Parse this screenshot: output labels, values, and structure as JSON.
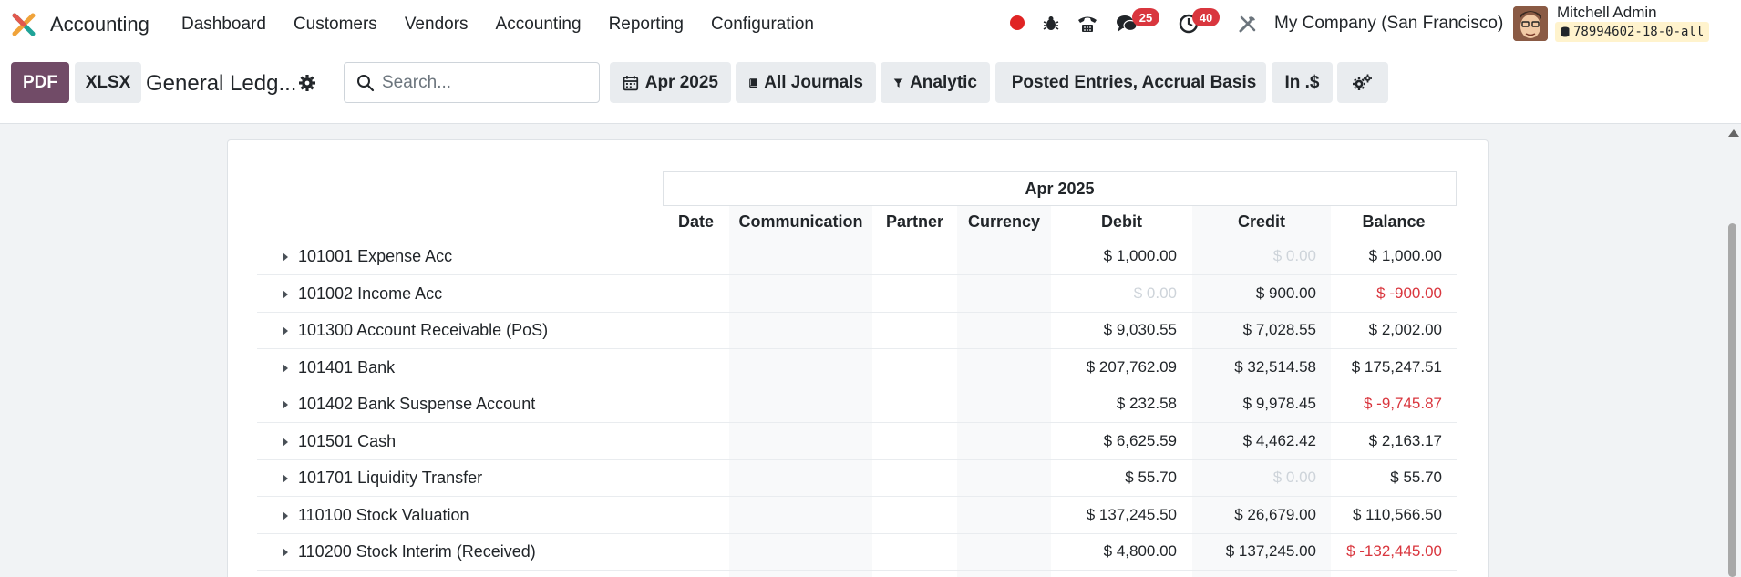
{
  "app": {
    "name": "Accounting",
    "menu": [
      "Dashboard",
      "Customers",
      "Vendors",
      "Accounting",
      "Reporting",
      "Configuration"
    ]
  },
  "systray": {
    "messages_count": "25",
    "activities_count": "40",
    "company": "My Company (San Francisco)",
    "user_name": "Mitchell Admin",
    "database": "78994602-18-0-all"
  },
  "toolbar": {
    "pdf_label": "PDF",
    "xlsx_label": "XLSX",
    "report_title": "General Ledg...",
    "search_placeholder": "Search...",
    "filters": {
      "date": "Apr 2025",
      "journals": "All Journals",
      "analytic": "Analytic",
      "options": "Posted Entries, Accrual Basis",
      "currency": "In .$"
    }
  },
  "report": {
    "period": "Apr 2025",
    "columns": [
      "Date",
      "Communication",
      "Partner",
      "Currency",
      "Debit",
      "Credit",
      "Balance"
    ],
    "rows": [
      {
        "account": "101001 Expense Acc",
        "debit": "$ 1,000.00",
        "credit": "$ 0.00",
        "balance": "$ 1,000.00"
      },
      {
        "account": "101002 Income Acc",
        "debit": "$ 0.00",
        "credit": "$ 900.00",
        "balance": "$ -900.00"
      },
      {
        "account": "101300 Account Receivable (PoS)",
        "debit": "$ 9,030.55",
        "credit": "$ 7,028.55",
        "balance": "$ 2,002.00"
      },
      {
        "account": "101401 Bank",
        "debit": "$ 207,762.09",
        "credit": "$ 32,514.58",
        "balance": "$ 175,247.51"
      },
      {
        "account": "101402 Bank Suspense Account",
        "debit": "$ 232.58",
        "credit": "$ 9,978.45",
        "balance": "$ -9,745.87"
      },
      {
        "account": "101501 Cash",
        "debit": "$ 6,625.59",
        "credit": "$ 4,462.42",
        "balance": "$ 2,163.17"
      },
      {
        "account": "101701 Liquidity Transfer",
        "debit": "$ 55.70",
        "credit": "$ 0.00",
        "balance": "$ 55.70"
      },
      {
        "account": "110100 Stock Valuation",
        "debit": "$ 137,245.50",
        "credit": "$ 26,679.00",
        "balance": "$ 110,566.50"
      },
      {
        "account": "110200 Stock Interim (Received)",
        "debit": "$ 4,800.00",
        "credit": "$ 137,245.00",
        "balance": "$ -132,445.00"
      }
    ]
  },
  "colors": {
    "brand": "#714b67",
    "negative": "#d9363e",
    "zero_muted": "#ced4da",
    "badge": "#d9363e",
    "record_dot": "#e02424"
  }
}
